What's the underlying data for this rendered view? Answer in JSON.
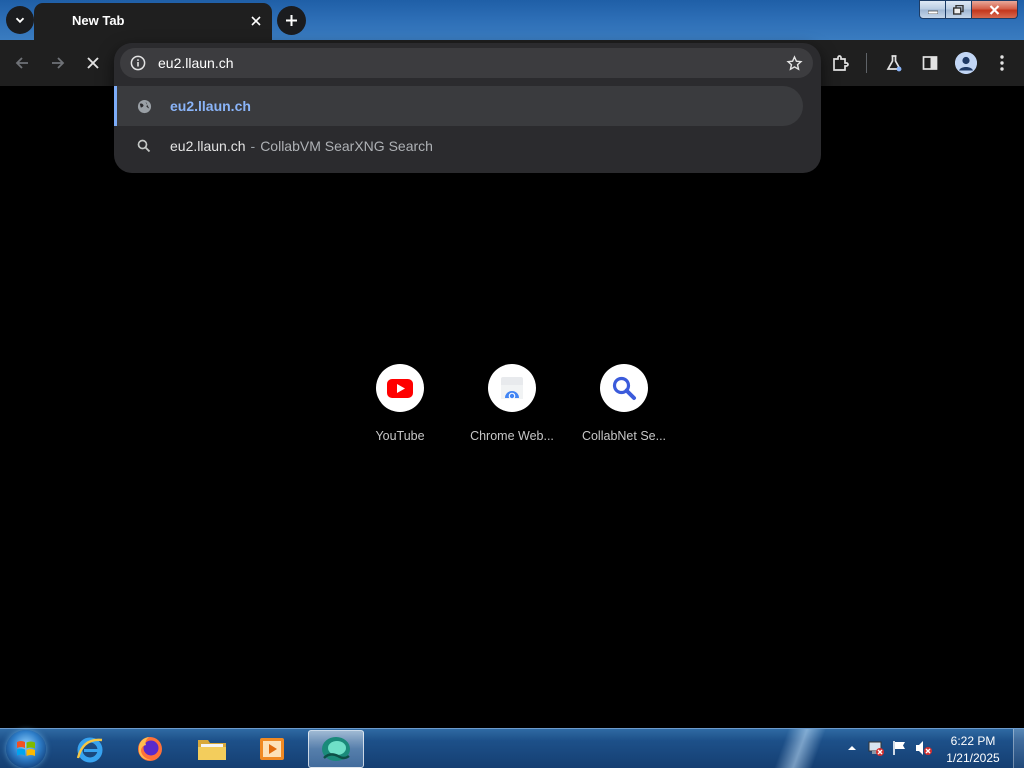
{
  "browser": {
    "tab": {
      "title": "New Tab"
    },
    "omnibox": {
      "value": "eu2.llaun.ch",
      "suggestions": [
        {
          "main": "eu2.llaun.ch",
          "sub": "",
          "icon": "globe-icon"
        },
        {
          "main": "eu2.llaun.ch",
          "separator": "-",
          "sub": "CollabVM SearXNG Search",
          "icon": "search-icon"
        }
      ]
    },
    "shortcuts": [
      {
        "label": "YouTube",
        "icon": "youtube-icon"
      },
      {
        "label": "Chrome Web...",
        "icon": "chrome-web-store-icon"
      },
      {
        "label": "CollabNet Se...",
        "icon": "magnifier-icon"
      }
    ]
  },
  "taskbar": {
    "apps": [
      "internet-explorer-icon",
      "firefox-icon",
      "file-explorer-icon",
      "media-player-icon",
      "collabvm-app-icon"
    ],
    "clock": {
      "time": "6:22 PM",
      "date": "1/21/2025"
    }
  },
  "colors": {
    "accent": "#8ab4f8",
    "toolbar": "#1f1f1f",
    "youtube": "#ff0000",
    "search_blue": "#3b5bdb"
  }
}
